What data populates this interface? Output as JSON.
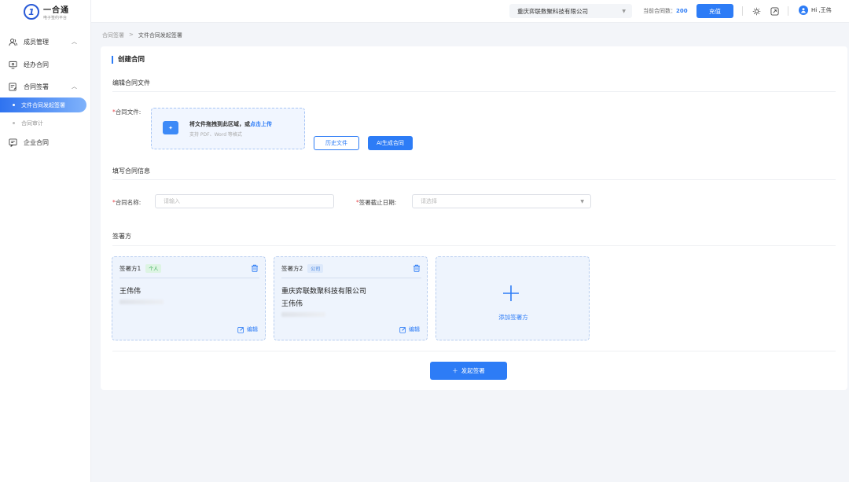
{
  "app": {
    "logo_mark": "1",
    "logo_title": "一合通",
    "logo_subtitle": "电子签约平台"
  },
  "sidebar": {
    "items": [
      {
        "label": "成员管理",
        "icon": "users-icon",
        "expanded": true
      },
      {
        "label": "经办合同",
        "icon": "monitor-icon"
      },
      {
        "label": "合同签署",
        "icon": "edit-doc-icon",
        "expanded": true
      },
      {
        "label": "企业合同",
        "icon": "chat-doc-icon"
      }
    ],
    "sub_items": [
      {
        "label": "文件合同发起签署",
        "active": true
      },
      {
        "label": "合同审计",
        "active": false
      }
    ]
  },
  "topbar": {
    "company": "重庆弈联数聚科技有限公司",
    "contract_count_label": "当前合同数：",
    "contract_count_value": "200",
    "recharge_label": "充值",
    "user_greeting": "Hi ,王伟"
  },
  "breadcrumb": {
    "parent": "合同签署",
    "separator": ">",
    "current": "文件合同发起签署"
  },
  "main": {
    "title": "创建合同",
    "section_file": "编辑合同文件",
    "file_label": "合同文件:",
    "upload_text": "将文件拖拽到此区域，或",
    "upload_link": "点击上传",
    "upload_hint": "支持 PDF、Word 等格式",
    "history_btn": "历史文件",
    "ai_btn": "AI生成合同",
    "section_info": "填写合同信息",
    "name_label": "合同名称:",
    "name_placeholder": "请输入",
    "deadline_label": "签署截止日期:",
    "deadline_placeholder": "请选择",
    "section_signers": "签署方",
    "parties": [
      {
        "title": "签署方1",
        "tag": "个人",
        "name": "王伟伟",
        "sub_name": "",
        "edit": "编辑"
      },
      {
        "title": "签署方2",
        "tag": "公司",
        "name": "重庆弈联数聚科技有限公司",
        "sub_name": "王伟伟",
        "edit": "编辑"
      }
    ],
    "add_party": "添加签署方",
    "submit": "发起签署"
  },
  "colors": {
    "primary": "#2d7cf6",
    "required": "#e5484d",
    "tag_green": "#2fa84f"
  }
}
